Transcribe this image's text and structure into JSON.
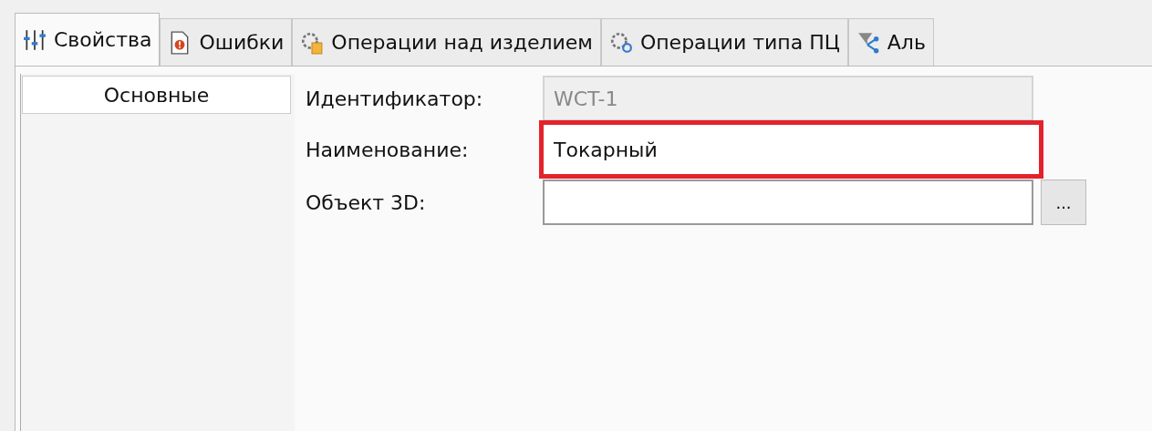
{
  "tabs": [
    {
      "label": "Свойства",
      "selected": true
    },
    {
      "label": "Ошибки",
      "selected": false
    },
    {
      "label": "Операции над изделием",
      "selected": false
    },
    {
      "label": "Операции типа ПЦ",
      "selected": false
    },
    {
      "label": "Аль",
      "selected": false
    }
  ],
  "sidebar": {
    "items": [
      {
        "label": "Основные",
        "selected": true
      }
    ]
  },
  "fields": [
    {
      "label": "Идентификатор:",
      "value": "WCT-1",
      "disabled": true,
      "highlighted": false
    },
    {
      "label": "Наименование:",
      "value": "Токарный",
      "disabled": false,
      "highlighted": true
    },
    {
      "label": "Объект 3D:",
      "disabled": false,
      "highlighted": false,
      "browse_label": "..."
    }
  ]
}
